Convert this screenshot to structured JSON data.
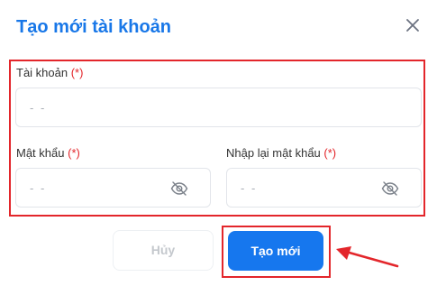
{
  "dialog": {
    "title": "Tạo mới tài khoản",
    "close_icon": "close-icon"
  },
  "form": {
    "account": {
      "label": "Tài khoản",
      "required_mark": "(*)",
      "placeholder": "- -"
    },
    "password": {
      "label": "Mật khẩu",
      "required_mark": "(*)",
      "placeholder": "- -",
      "toggle_icon": "eye-slash-icon"
    },
    "confirm_password": {
      "label": "Nhập lại mật khẩu",
      "required_mark": "(*)",
      "placeholder": "- -",
      "toggle_icon": "eye-slash-icon"
    }
  },
  "actions": {
    "cancel_label": "Hủy",
    "submit_label": "Tạo mới"
  },
  "colors": {
    "title": "#1877e8",
    "primary": "#1677ee",
    "highlight": "#e3262b",
    "required": "#e3262b"
  }
}
